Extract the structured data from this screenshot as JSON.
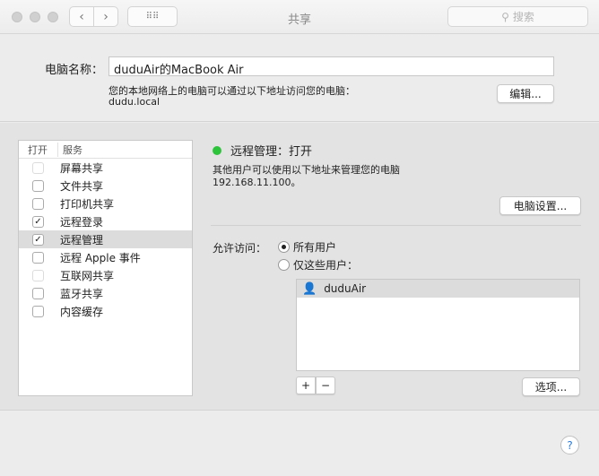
{
  "window": {
    "title": "共享",
    "search_placeholder": "搜索"
  },
  "computer_name": {
    "label": "电脑名称：",
    "value": "duduAir的MacBook Air",
    "hint": "您的本地网络上的电脑可以通过以下地址访问您的电脑：",
    "address": "dudu.local",
    "edit_button": "编辑..."
  },
  "services": {
    "col_on": "打开",
    "col_service": "服务",
    "items": [
      {
        "label": "屏幕共享",
        "checked": false,
        "disabled": true
      },
      {
        "label": "文件共享",
        "checked": false,
        "disabled": false
      },
      {
        "label": "打印机共享",
        "checked": false,
        "disabled": false
      },
      {
        "label": "远程登录",
        "checked": true,
        "disabled": false
      },
      {
        "label": "远程管理",
        "checked": true,
        "disabled": false,
        "selected": true
      },
      {
        "label": "远程 Apple 事件",
        "checked": false,
        "disabled": false
      },
      {
        "label": "互联网共享",
        "checked": false,
        "disabled": true
      },
      {
        "label": "蓝牙共享",
        "checked": false,
        "disabled": false
      },
      {
        "label": "内容缓存",
        "checked": false,
        "disabled": false
      }
    ]
  },
  "detail": {
    "status": "远程管理：打开",
    "status_color": "#2dc43c",
    "desc": "其他用户可以使用以下地址来管理您的电脑",
    "address": "192.168.11.100。",
    "settings_button": "电脑设置...",
    "allow_label": "允许访问：",
    "opt_all": "所有用户",
    "opt_some": "仅这些用户：",
    "users": [
      "duduAir"
    ],
    "options_button": "选项..."
  },
  "help": "?"
}
